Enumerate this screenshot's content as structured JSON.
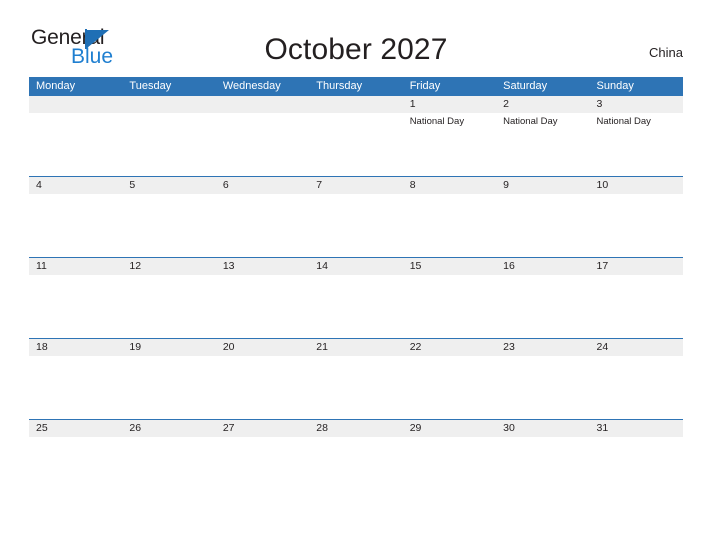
{
  "logo": {
    "word_one": "General",
    "word_two": "Blue",
    "triangle_icon": "triangle-icon",
    "color_dark": "#231f20",
    "color_blue": "#1f7fd0"
  },
  "header": {
    "title": "October 2027",
    "country": "China"
  },
  "calendar": {
    "header_bg": "#2e74b5",
    "band_bg": "#efefef",
    "weekdays": [
      "Monday",
      "Tuesday",
      "Wednesday",
      "Thursday",
      "Friday",
      "Saturday",
      "Sunday"
    ],
    "weeks": [
      [
        {
          "date": "",
          "events": []
        },
        {
          "date": "",
          "events": []
        },
        {
          "date": "",
          "events": []
        },
        {
          "date": "",
          "events": []
        },
        {
          "date": "1",
          "events": [
            "National Day"
          ]
        },
        {
          "date": "2",
          "events": [
            "National Day"
          ]
        },
        {
          "date": "3",
          "events": [
            "National Day"
          ]
        }
      ],
      [
        {
          "date": "4",
          "events": []
        },
        {
          "date": "5",
          "events": []
        },
        {
          "date": "6",
          "events": []
        },
        {
          "date": "7",
          "events": []
        },
        {
          "date": "8",
          "events": []
        },
        {
          "date": "9",
          "events": []
        },
        {
          "date": "10",
          "events": []
        }
      ],
      [
        {
          "date": "11",
          "events": []
        },
        {
          "date": "12",
          "events": []
        },
        {
          "date": "13",
          "events": []
        },
        {
          "date": "14",
          "events": []
        },
        {
          "date": "15",
          "events": []
        },
        {
          "date": "16",
          "events": []
        },
        {
          "date": "17",
          "events": []
        }
      ],
      [
        {
          "date": "18",
          "events": []
        },
        {
          "date": "19",
          "events": []
        },
        {
          "date": "20",
          "events": []
        },
        {
          "date": "21",
          "events": []
        },
        {
          "date": "22",
          "events": []
        },
        {
          "date": "23",
          "events": []
        },
        {
          "date": "24",
          "events": []
        }
      ],
      [
        {
          "date": "25",
          "events": []
        },
        {
          "date": "26",
          "events": []
        },
        {
          "date": "27",
          "events": []
        },
        {
          "date": "28",
          "events": []
        },
        {
          "date": "29",
          "events": []
        },
        {
          "date": "30",
          "events": []
        },
        {
          "date": "31",
          "events": []
        }
      ]
    ]
  }
}
